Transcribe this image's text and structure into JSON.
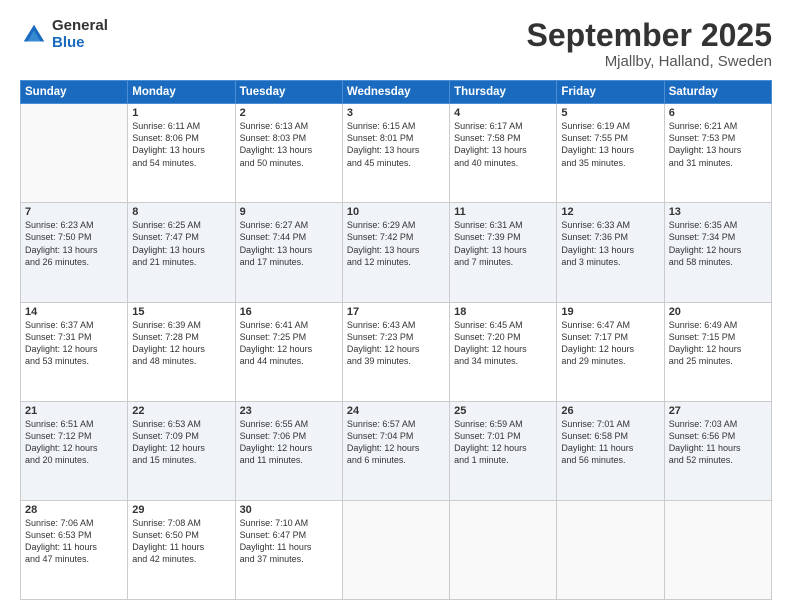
{
  "logo": {
    "general": "General",
    "blue": "Blue"
  },
  "header": {
    "month": "September 2025",
    "location": "Mjallby, Halland, Sweden"
  },
  "weekdays": [
    "Sunday",
    "Monday",
    "Tuesday",
    "Wednesday",
    "Thursday",
    "Friday",
    "Saturday"
  ],
  "weeks": [
    [
      {
        "day": "",
        "info": ""
      },
      {
        "day": "1",
        "info": "Sunrise: 6:11 AM\nSunset: 8:06 PM\nDaylight: 13 hours\nand 54 minutes."
      },
      {
        "day": "2",
        "info": "Sunrise: 6:13 AM\nSunset: 8:03 PM\nDaylight: 13 hours\nand 50 minutes."
      },
      {
        "day": "3",
        "info": "Sunrise: 6:15 AM\nSunset: 8:01 PM\nDaylight: 13 hours\nand 45 minutes."
      },
      {
        "day": "4",
        "info": "Sunrise: 6:17 AM\nSunset: 7:58 PM\nDaylight: 13 hours\nand 40 minutes."
      },
      {
        "day": "5",
        "info": "Sunrise: 6:19 AM\nSunset: 7:55 PM\nDaylight: 13 hours\nand 35 minutes."
      },
      {
        "day": "6",
        "info": "Sunrise: 6:21 AM\nSunset: 7:53 PM\nDaylight: 13 hours\nand 31 minutes."
      }
    ],
    [
      {
        "day": "7",
        "info": "Sunrise: 6:23 AM\nSunset: 7:50 PM\nDaylight: 13 hours\nand 26 minutes."
      },
      {
        "day": "8",
        "info": "Sunrise: 6:25 AM\nSunset: 7:47 PM\nDaylight: 13 hours\nand 21 minutes."
      },
      {
        "day": "9",
        "info": "Sunrise: 6:27 AM\nSunset: 7:44 PM\nDaylight: 13 hours\nand 17 minutes."
      },
      {
        "day": "10",
        "info": "Sunrise: 6:29 AM\nSunset: 7:42 PM\nDaylight: 13 hours\nand 12 minutes."
      },
      {
        "day": "11",
        "info": "Sunrise: 6:31 AM\nSunset: 7:39 PM\nDaylight: 13 hours\nand 7 minutes."
      },
      {
        "day": "12",
        "info": "Sunrise: 6:33 AM\nSunset: 7:36 PM\nDaylight: 13 hours\nand 3 minutes."
      },
      {
        "day": "13",
        "info": "Sunrise: 6:35 AM\nSunset: 7:34 PM\nDaylight: 12 hours\nand 58 minutes."
      }
    ],
    [
      {
        "day": "14",
        "info": "Sunrise: 6:37 AM\nSunset: 7:31 PM\nDaylight: 12 hours\nand 53 minutes."
      },
      {
        "day": "15",
        "info": "Sunrise: 6:39 AM\nSunset: 7:28 PM\nDaylight: 12 hours\nand 48 minutes."
      },
      {
        "day": "16",
        "info": "Sunrise: 6:41 AM\nSunset: 7:25 PM\nDaylight: 12 hours\nand 44 minutes."
      },
      {
        "day": "17",
        "info": "Sunrise: 6:43 AM\nSunset: 7:23 PM\nDaylight: 12 hours\nand 39 minutes."
      },
      {
        "day": "18",
        "info": "Sunrise: 6:45 AM\nSunset: 7:20 PM\nDaylight: 12 hours\nand 34 minutes."
      },
      {
        "day": "19",
        "info": "Sunrise: 6:47 AM\nSunset: 7:17 PM\nDaylight: 12 hours\nand 29 minutes."
      },
      {
        "day": "20",
        "info": "Sunrise: 6:49 AM\nSunset: 7:15 PM\nDaylight: 12 hours\nand 25 minutes."
      }
    ],
    [
      {
        "day": "21",
        "info": "Sunrise: 6:51 AM\nSunset: 7:12 PM\nDaylight: 12 hours\nand 20 minutes."
      },
      {
        "day": "22",
        "info": "Sunrise: 6:53 AM\nSunset: 7:09 PM\nDaylight: 12 hours\nand 15 minutes."
      },
      {
        "day": "23",
        "info": "Sunrise: 6:55 AM\nSunset: 7:06 PM\nDaylight: 12 hours\nand 11 minutes."
      },
      {
        "day": "24",
        "info": "Sunrise: 6:57 AM\nSunset: 7:04 PM\nDaylight: 12 hours\nand 6 minutes."
      },
      {
        "day": "25",
        "info": "Sunrise: 6:59 AM\nSunset: 7:01 PM\nDaylight: 12 hours\nand 1 minute."
      },
      {
        "day": "26",
        "info": "Sunrise: 7:01 AM\nSunset: 6:58 PM\nDaylight: 11 hours\nand 56 minutes."
      },
      {
        "day": "27",
        "info": "Sunrise: 7:03 AM\nSunset: 6:56 PM\nDaylight: 11 hours\nand 52 minutes."
      }
    ],
    [
      {
        "day": "28",
        "info": "Sunrise: 7:06 AM\nSunset: 6:53 PM\nDaylight: 11 hours\nand 47 minutes."
      },
      {
        "day": "29",
        "info": "Sunrise: 7:08 AM\nSunset: 6:50 PM\nDaylight: 11 hours\nand 42 minutes."
      },
      {
        "day": "30",
        "info": "Sunrise: 7:10 AM\nSunset: 6:47 PM\nDaylight: 11 hours\nand 37 minutes."
      },
      {
        "day": "",
        "info": ""
      },
      {
        "day": "",
        "info": ""
      },
      {
        "day": "",
        "info": ""
      },
      {
        "day": "",
        "info": ""
      }
    ]
  ]
}
